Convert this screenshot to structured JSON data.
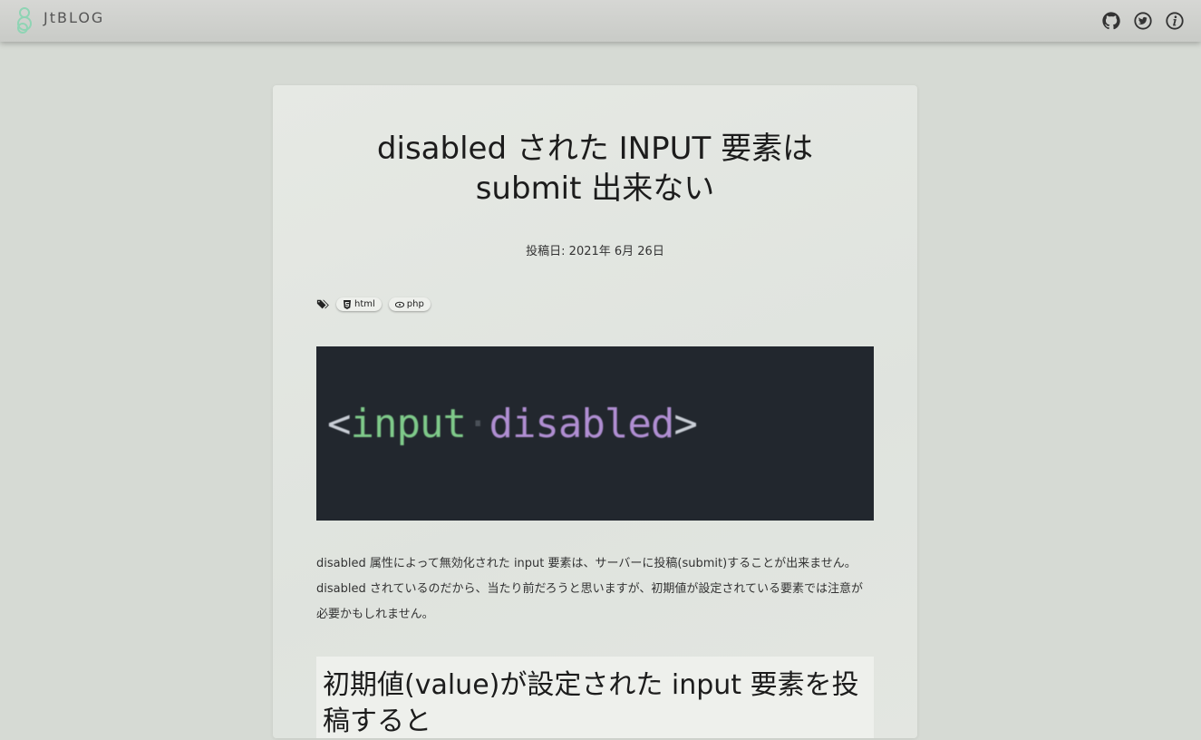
{
  "header": {
    "brand_name": "JtBLOG",
    "icons": [
      "github-icon",
      "twitter-icon",
      "info-icon"
    ]
  },
  "post": {
    "title_line1": "disabled された INPUT 要素は",
    "title_line2": "submit 出来ない",
    "date_label": "投稿日: 2021年 6月 26日",
    "tags": [
      {
        "label": "html",
        "icon": "html5-icon"
      },
      {
        "label": "php",
        "icon": "php-icon"
      }
    ],
    "hero_code": {
      "open": "<",
      "tag": "input",
      "dot": "·",
      "attr": "disabled",
      "close": ">"
    },
    "body_text": "disabled 属性によって無効化された input 要素は、サーバーに投稿(submit)することが出来ません。disabled されているのだから、当たり前だろうと思いますが、初期値が設定されている要素では注意が必要かもしれません。",
    "section_heading": "初期値(value)が設定された input 要素を投稿すると"
  },
  "colors": {
    "background": "#d6dad4",
    "card": "#e3e6e1",
    "code_bg": "#22272e",
    "code_tag": "#7fca8a",
    "code_attr": "#b08ed2"
  }
}
